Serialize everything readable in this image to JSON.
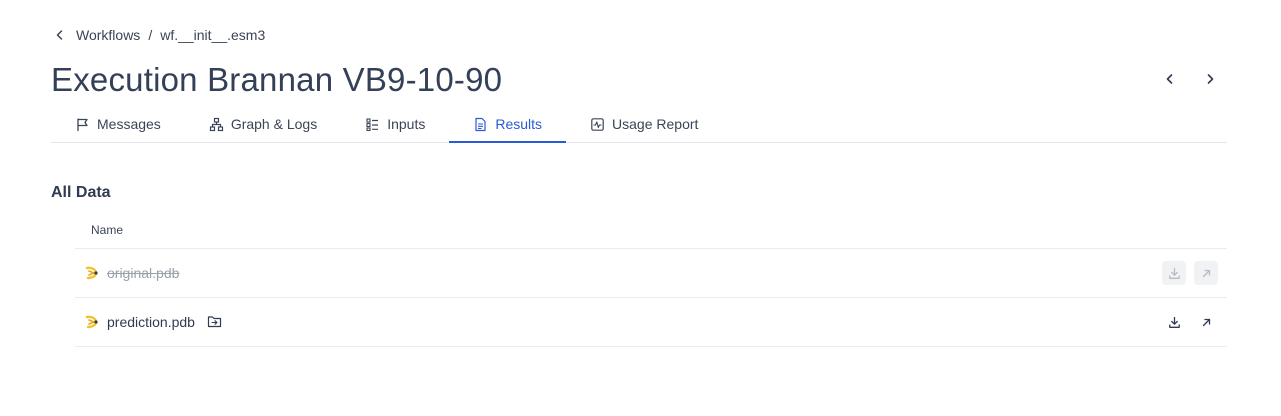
{
  "breadcrumb": {
    "parent": "Workflows",
    "separator": "/",
    "current": "wf.__init__.esm3"
  },
  "page": {
    "title": "Execution Brannan VB9-10-90"
  },
  "tabs": [
    {
      "label": "Messages",
      "icon": "flag-icon",
      "active": false
    },
    {
      "label": "Graph & Logs",
      "icon": "graph-icon",
      "active": false
    },
    {
      "label": "Inputs",
      "icon": "list-icon",
      "active": false
    },
    {
      "label": "Results",
      "icon": "document-icon",
      "active": true
    },
    {
      "label": "Usage Report",
      "icon": "activity-icon",
      "active": false
    }
  ],
  "section": {
    "title": "All Data",
    "column_name": "Name"
  },
  "files": [
    {
      "name": "original.pdb",
      "icon": "protein-icon",
      "disabled": true
    },
    {
      "name": "prediction.pdb",
      "icon": "protein-icon",
      "disabled": false
    }
  ],
  "colors": {
    "accent": "#2b5ad6",
    "text": "#2f3b52",
    "muted": "#9aa1ad",
    "protein_yellow": "#f2c12e"
  }
}
